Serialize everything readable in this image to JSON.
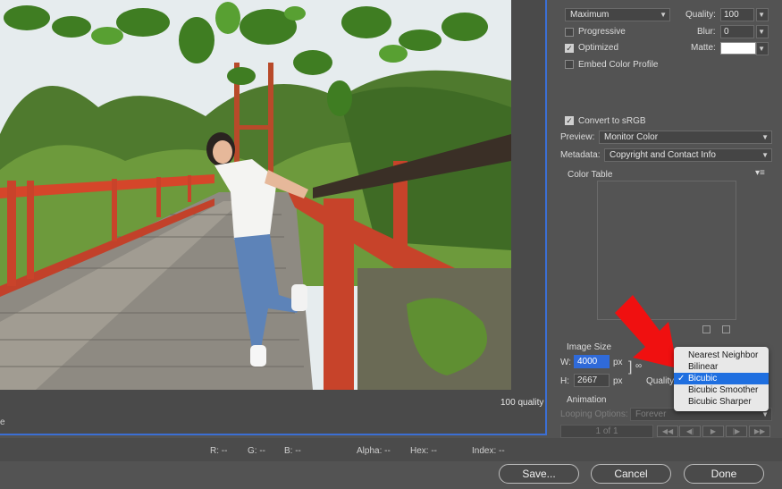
{
  "preview": {
    "quality_caption": "100 quality",
    "edge_label": "e"
  },
  "status_bar": {
    "r": "R: --",
    "g": "G: --",
    "b": "B: --",
    "alpha": "Alpha: --",
    "hex": "Hex: --",
    "index": "Index: --"
  },
  "buttons": {
    "save": "Save...",
    "cancel": "Cancel",
    "done": "Done"
  },
  "settings": {
    "compression": "Maximum",
    "quality_label": "Quality:",
    "quality_value": "100",
    "progressive": "Progressive",
    "blur_label": "Blur:",
    "blur_value": "0",
    "optimized": "Optimized",
    "matte_label": "Matte:",
    "embed_profile": "Embed Color Profile",
    "convert_srgb": "Convert to sRGB",
    "preview_label": "Preview:",
    "preview_value": "Monitor Color",
    "metadata_label": "Metadata:",
    "metadata_value": "Copyright and Contact Info",
    "color_table": "Color Table"
  },
  "image_size": {
    "title": "Image Size",
    "w_label": "W:",
    "w_value": "4000",
    "h_label": "H:",
    "h_value": "2667",
    "unit": "px",
    "quality_label": "Quality"
  },
  "animation": {
    "title": "Animation",
    "looping_label": "Looping Options:",
    "looping_value": "Forever",
    "frame_counter": "1 of 1"
  },
  "resample_menu": {
    "options": [
      "Nearest Neighbor",
      "Bilinear",
      "Bicubic",
      "Bicubic Smoother",
      "Bicubic Sharper"
    ],
    "selected": "Bicubic"
  },
  "colors": {
    "accent": "#1f6fe0",
    "frame_border": "#3b6fd4",
    "arrow": "#f01010"
  }
}
